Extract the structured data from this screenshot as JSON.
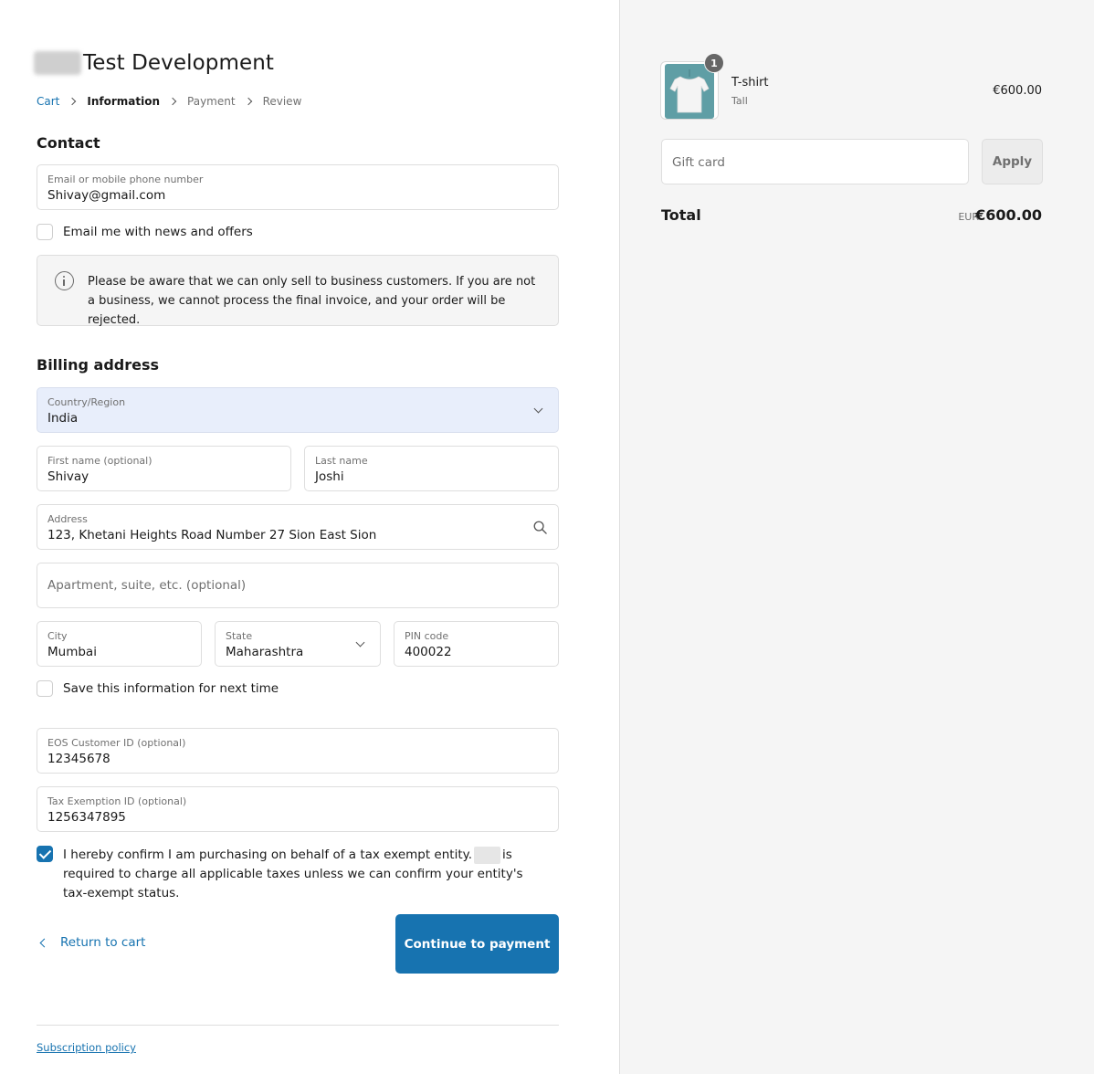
{
  "header": {
    "shop_name": "Test Development"
  },
  "breadcrumb": {
    "cart": "Cart",
    "information": "Information",
    "payment": "Payment",
    "review": "Review"
  },
  "contact": {
    "heading": "Contact",
    "email_label": "Email or mobile phone number",
    "email_value": "Shivay@gmail.com",
    "news_checkbox_label": "Email me with news and offers",
    "news_checked": false,
    "notice_text": "Please be aware that we can only sell to business customers. If you are not a business, we cannot process the final invoice, and your order will be rejected."
  },
  "billing": {
    "heading": "Billing address",
    "country_label": "Country/Region",
    "country_value": "India",
    "first_name_label": "First name (optional)",
    "first_name_value": "Shivay",
    "last_name_label": "Last name",
    "last_name_value": "Joshi",
    "address_label": "Address",
    "address_value": "123, Khetani Heights Road Number 27 Sion East Sion",
    "apartment_placeholder": "Apartment, suite, etc. (optional)",
    "city_label": "City",
    "city_value": "Mumbai",
    "state_label": "State",
    "state_value": "Maharashtra",
    "pin_label": "PIN code",
    "pin_value": "400022",
    "save_info_label": "Save this information for next time",
    "save_info_checked": false,
    "eos_label": "EOS Customer ID (optional)",
    "eos_value": "12345678",
    "tax_label": "Tax Exemption ID (optional)",
    "tax_value": "1256347895",
    "confirm_text_part1": "I hereby confirm I am purchasing on behalf of a tax exempt entity.",
    "confirm_text_part2": "is required to charge all applicable taxes unless we can confirm your entity's tax-exempt status.",
    "confirm_checked": true
  },
  "actions": {
    "return_label": "Return to cart",
    "continue_label": "Continue to payment"
  },
  "footer": {
    "subscription_policy": "Subscription policy"
  },
  "order_summary": {
    "item": {
      "name": "T-shirt",
      "variant": "Tall",
      "price": "€600.00",
      "quantity": "1"
    },
    "gift_card_placeholder": "Gift card",
    "apply_label": "Apply",
    "total_label": "Total",
    "currency": "EUR",
    "total_value": "€600.00"
  },
  "colors": {
    "accent": "#1773b0",
    "summary_bg": "#f5f5f5",
    "product_image": "#5f9ea5"
  }
}
